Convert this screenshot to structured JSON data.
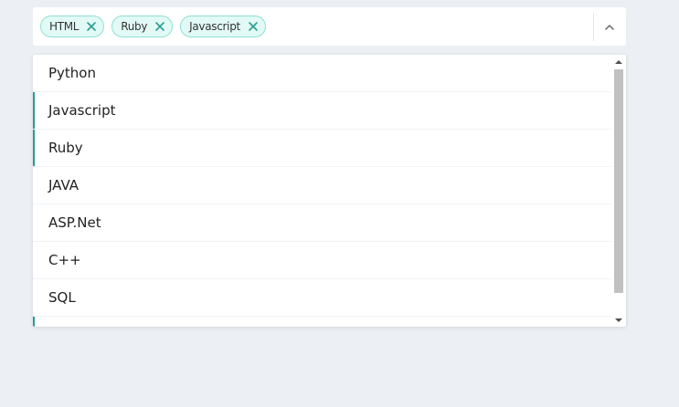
{
  "select": {
    "chips": [
      {
        "label": "HTML",
        "remove_icon": "close-icon"
      },
      {
        "label": "Ruby",
        "remove_icon": "close-icon"
      },
      {
        "label": "Javascript",
        "remove_icon": "close-icon"
      }
    ],
    "toggle_icon": "chevron-up-icon"
  },
  "menu": {
    "options": [
      {
        "label": "Python",
        "selected": false
      },
      {
        "label": "Javascript",
        "selected": true
      },
      {
        "label": "Ruby",
        "selected": true
      },
      {
        "label": "JAVA",
        "selected": false
      },
      {
        "label": "ASP.Net",
        "selected": false
      },
      {
        "label": "C++",
        "selected": false
      },
      {
        "label": "SQL",
        "selected": false
      },
      {
        "label": "",
        "selected": true
      }
    ]
  },
  "colors": {
    "accent": "#2a9d8f",
    "chip_background": "#e2faf6",
    "chip_border": "#8ee0d2",
    "page_background": "#ecf0f4"
  }
}
